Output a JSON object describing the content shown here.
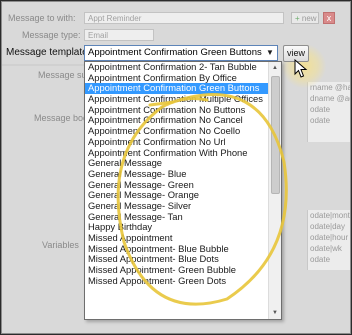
{
  "background": {
    "message_to_with_label": "Message to with:",
    "message_to_with_value": "Appt Reminder",
    "new_button_label": "new",
    "delete_button_label": "x",
    "message_type_label": "Message type:",
    "message_type_value": "Email",
    "message_subject_label": "Message subject",
    "message_body_label": "Message body",
    "variables_label": "Variables",
    "side_pane_top": [
      "rname @hashe",
      "dname @ada",
      "odate",
      "odate"
    ],
    "side_pane_bottom": [
      "odate|month",
      "odate|day",
      "odate|hour",
      "odate|wk",
      "odate"
    ]
  },
  "template_row": {
    "label": "Message template:",
    "selected_value": "Appointment Confirmation Green Buttons",
    "view_button_label": "view"
  },
  "dropdown": {
    "selected_index": 2,
    "items": [
      "Appointment Confirmation 2- Tan Bubble",
      "Appointment Confirmation By Office",
      "Appointment Confirmation Green Buttons",
      "Appointment Confirmation Multiple Offices",
      "Appointment Confirmation No Buttons",
      "Appointment Confirmation No Cancel",
      "Appointment Confirmation No Coello",
      "Appointment Confirmation No Url",
      "Appointment Confirmation With Phone",
      "General Message",
      "General Message- Blue",
      "General Message- Green",
      "General Message- Orange",
      "General Message- Silver",
      "General Message- Tan",
      "Happy Birthday",
      "Missed Appointment",
      "Missed Appointment- Blue Bubble",
      "Missed Appointment- Blue Dots",
      "Missed Appointment- Green Bubble",
      "Missed Appointment- Green Dots"
    ]
  },
  "colors": {
    "selection": "#3399ff",
    "callout": "#e8c53a"
  },
  "icons": {
    "dropdown_arrow": "chevron-down-icon",
    "cursor": "mouse-pointer-icon",
    "scroll_up": "scroll-up-icon",
    "scroll_down": "scroll-down-icon"
  }
}
